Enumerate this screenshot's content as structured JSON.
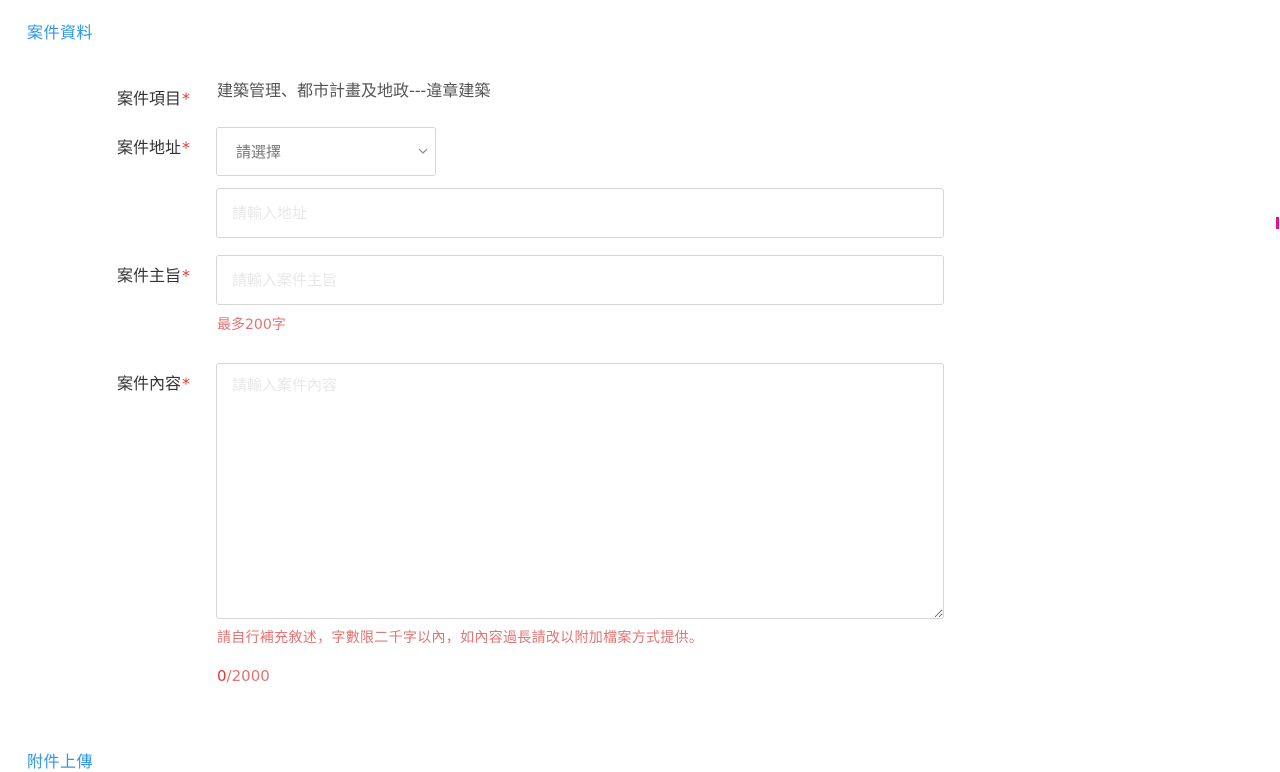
{
  "sections": {
    "case_info_title": "案件資料",
    "attachments_title": "附件上傳"
  },
  "form": {
    "required_mark": "*",
    "item": {
      "label": "案件項目",
      "value": "建築管理、都市計畫及地政---違章建築"
    },
    "address": {
      "label": "案件地址",
      "select_placeholder": "請選擇",
      "detail_placeholder": "請輸入地址"
    },
    "subject": {
      "label": "案件主旨",
      "placeholder": "請輸入案件主旨",
      "hint": "最多200字"
    },
    "content": {
      "label": "案件內容",
      "placeholder": "請輸入案件內容",
      "hint": "請自行補充敘述，字數限二千字以內，如內容過長請改以附加檔案方式提供。",
      "counter_current": "0",
      "counter_max": "/2000"
    }
  },
  "colors": {
    "accent": "#2f96e8",
    "required": "#e53935",
    "hint": "#e57373",
    "edge_mark": "#e0148a"
  }
}
